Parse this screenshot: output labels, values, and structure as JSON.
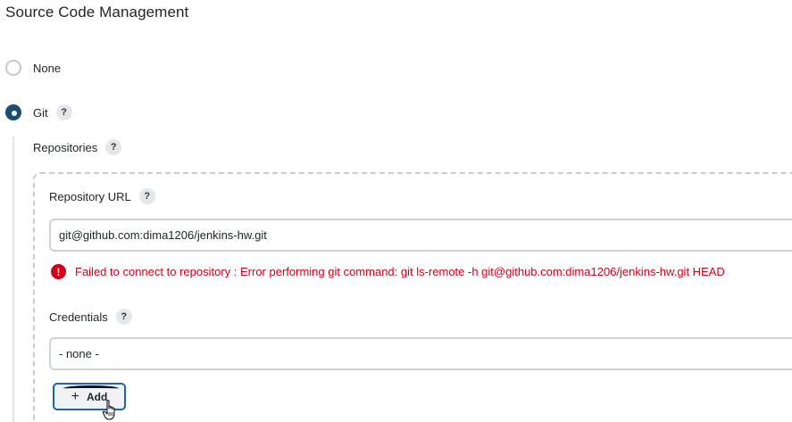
{
  "section": {
    "title": "Source Code Management"
  },
  "scm_options": [
    {
      "label": "None",
      "selected": false
    },
    {
      "label": "Git",
      "selected": true
    }
  ],
  "git": {
    "repositories_label": "Repositories",
    "repo_url_label": "Repository URL",
    "repo_url_value": "git@github.com:dima1206/jenkins-hw.git",
    "error_message": "Failed to connect to repository : Error performing git command: git ls-remote -h git@github.com:dima1206/jenkins-hw.git HEAD",
    "credentials_label": "Credentials",
    "credentials_value": "- none -",
    "add_button_label": "Add"
  },
  "help_glyph": "?",
  "error_glyph": "!",
  "colors": {
    "accent": "#1a4d73",
    "error": "#d4001a",
    "button_border": "#1a62b4"
  },
  "icons": [
    "help-icon",
    "error-icon",
    "plus-icon",
    "hand-cursor-icon"
  ]
}
